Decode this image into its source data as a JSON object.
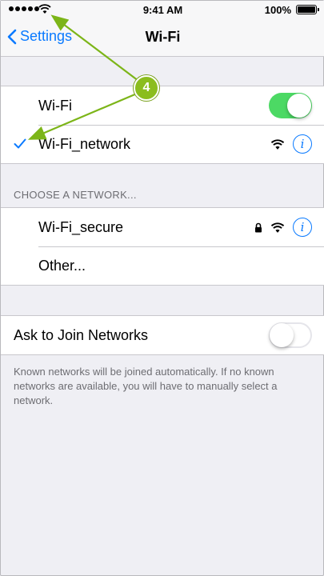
{
  "status_bar": {
    "time": "9:41 AM",
    "battery": "100%",
    "icons": [
      "signal-dots-icon",
      "wifi-icon",
      "battery-icon"
    ]
  },
  "nav": {
    "back_label": "Settings",
    "title": "Wi-Fi"
  },
  "wifi_group": {
    "wifi_label": "Wi-Fi",
    "wifi_enabled": true,
    "connected_network": "Wi-Fi_network"
  },
  "choose_network": {
    "header": "CHOOSE A NETWORK...",
    "networks": [
      {
        "name": "Wi-Fi_secure",
        "locked": true
      },
      {
        "name": "Other..."
      }
    ]
  },
  "ask_to_join": {
    "label": "Ask to Join Networks",
    "enabled": false,
    "note": "Known networks will be joined automatically. If no known networks are available, you will have to manually select a network."
  },
  "callout": {
    "number": "4",
    "color": "#8bbd1e"
  },
  "colors": {
    "accent": "#0a7aff",
    "toggle_on": "#4cd964",
    "background": "#efeff4"
  }
}
